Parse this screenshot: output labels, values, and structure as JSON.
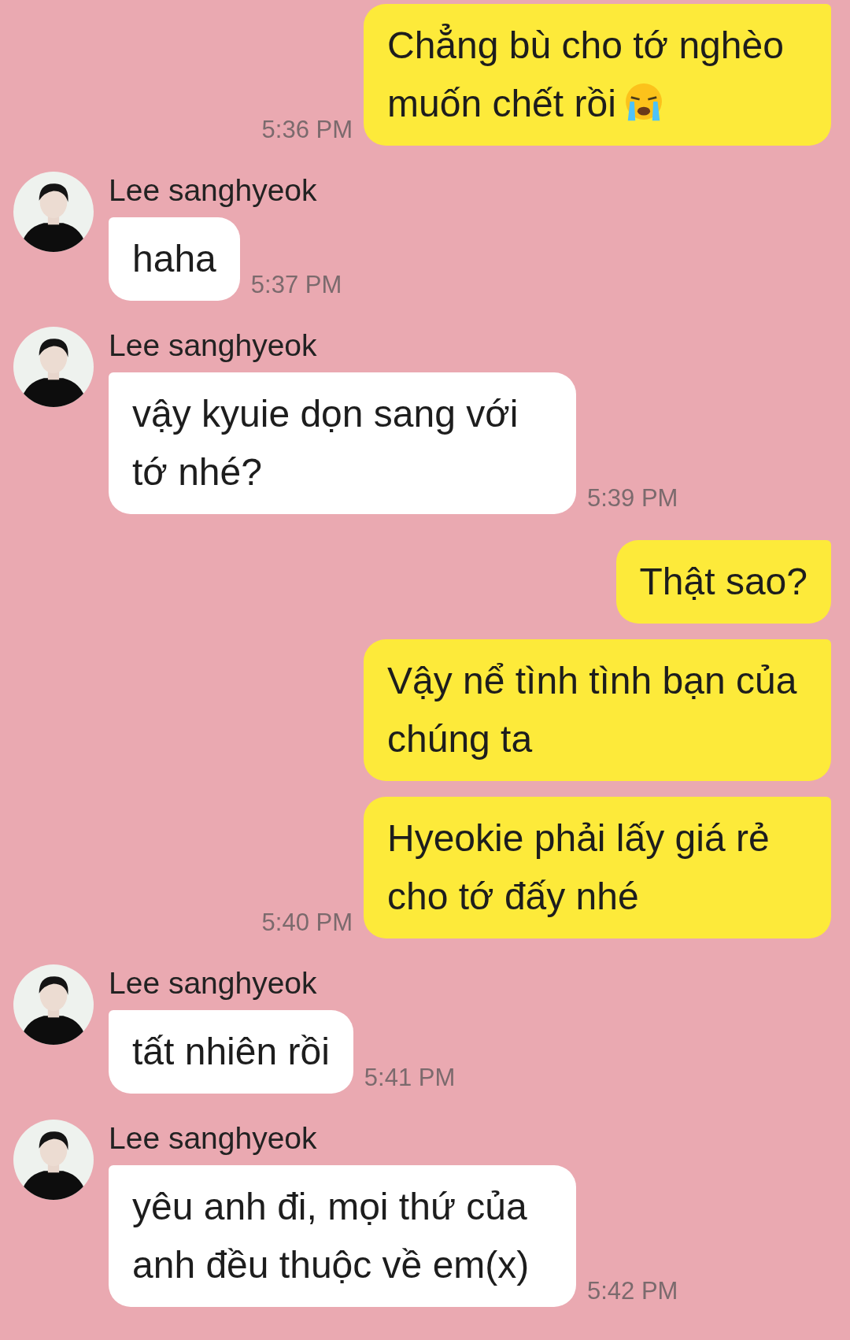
{
  "messages": [
    {
      "kind": "sent",
      "text": "Chẳng bù cho tớ nghèo muốn chết rồi",
      "has_icon": true,
      "time": "5:36 PM"
    },
    {
      "kind": "received",
      "sender": "Lee sanghyeok",
      "text": "haha",
      "time": "5:37 PM"
    },
    {
      "kind": "received",
      "sender": "Lee sanghyeok",
      "text": "vậy kyuie dọn sang với tớ nhé?",
      "time": "5:39 PM"
    },
    {
      "kind": "sent",
      "text": "Thật sao?"
    },
    {
      "kind": "sent",
      "text": "Vậy nể tình tình bạn của chúng ta"
    },
    {
      "kind": "sent",
      "text": "Hyeokie phải lấy giá rẻ cho tớ đấy nhé",
      "time": "5:40 PM"
    },
    {
      "kind": "received",
      "sender": "Lee sanghyeok",
      "text": "tất nhiên rồi",
      "time": "5:41 PM"
    },
    {
      "kind": "received",
      "sender": "Lee sanghyeok",
      "text": "yêu anh đi, mọi thứ của anh đều thuộc về em(x)",
      "time": "5:42 PM"
    }
  ]
}
